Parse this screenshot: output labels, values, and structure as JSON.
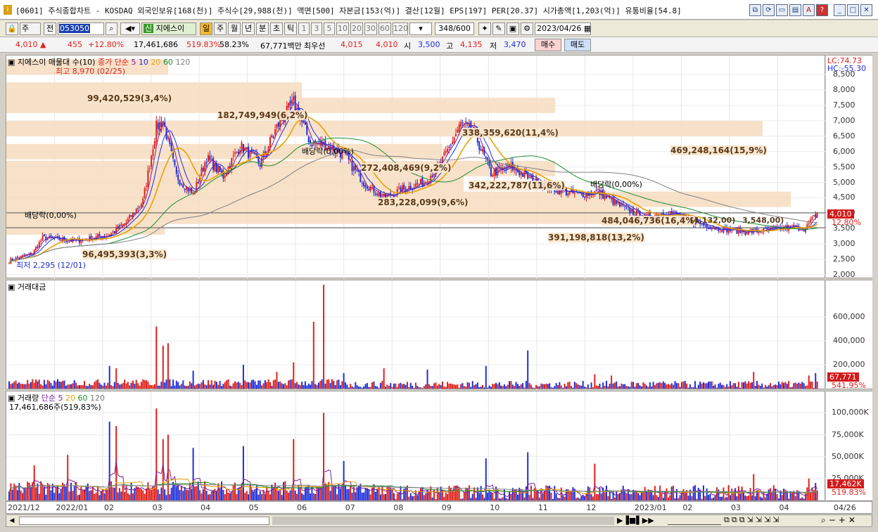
{
  "title": {
    "text": "[0601] 주식종합차트 - KOSDAQ 외국인보유[168(천)] 주식수[29,988(천)] 액면[500] 자본금[153(억)] 결산[12월] EPS[197] PER[20.37] 시가총액[1,203(억)] 유통비율[54.8]",
    "buttons": [
      "restore-icon",
      "refresh-icon",
      "window-icon",
      "print-icon",
      "font-icon",
      "help-icon",
      "minimize-icon",
      "maximize-icon",
      "close-icon"
    ]
  },
  "toolbar1": {
    "market": "주",
    "prev": "전",
    "code": "053050",
    "stock_name": "지에스이",
    "periods": [
      "일",
      "주",
      "월",
      "년",
      "분",
      "초",
      "틱"
    ],
    "active_period": "일",
    "minutes": [
      "1",
      "3",
      "5",
      "10",
      "20",
      "30",
      "60",
      "120"
    ],
    "count": "348",
    "count_total": "/600",
    "date": "2023/04/26"
  },
  "quote": {
    "price": "4,010",
    "change": "455",
    "change_pct": "+12.80%",
    "volume": "17,461,686",
    "vol_pct": "519.83%",
    "ratio": "58.23%",
    "amount": "67,771백만",
    "best_label": "최우선",
    "best_ask": "4,015",
    "best_bid": "4,010",
    "open_label": "시",
    "open": "3,500",
    "high_label": "고",
    "high": "4,135",
    "low_label": "저",
    "low": "3,470",
    "buy": "매수",
    "sell": "매도"
  },
  "price_panel": {
    "title": "지에스이 매물대 수(10)",
    "ma_title": "종가 단순",
    "ma_periods": [
      "5",
      "10",
      "20",
      "60",
      "120"
    ],
    "lc": "LC:74.73",
    "hc": "HC:-55.30",
    "y_ticks": [
      "8,500",
      "8,000",
      "7,500",
      "7,000",
      "6,500",
      "6,000",
      "5,500",
      "5,000",
      "4,500",
      "4,000",
      "3,500",
      "3,000",
      "2,500",
      "2,000"
    ],
    "last_price": "4,010",
    "last_pct": "12.80%",
    "high_note": "최고 8,970 (02/25)",
    "low_note": "최저 2,295 (12/01)",
    "profile_labels": [
      "99,420,529(3,4%)",
      "182,749,949(6,2%)",
      "338,359,620(11,4%)",
      "469,248,164(15,9%)",
      "272,408,469(9,2%)",
      "342,222,787(11,6%)",
      "283,228,099(9,6%)",
      "484,046,736(16,4%)",
      "391,198,818(13,2%)",
      "96,495,393(3,3%)"
    ],
    "dividend_labels": [
      "배당락(0,00%)",
      "배당락(0,00%)",
      "배당락(0,00%)"
    ],
    "box_labels": [
      "(4,132,00)",
      "3,548,00)"
    ]
  },
  "amount_panel": {
    "title": "거래대금",
    "y_ticks": [
      "600,000",
      "400,000",
      "200,000"
    ],
    "last_value": "67,771",
    "last_pct": "541.95%"
  },
  "volume_panel": {
    "title": "거래량",
    "ma_title": "단순",
    "ma_periods": [
      "5",
      "20",
      "60",
      "120"
    ],
    "value_line": "17,461,686주(519,83%)",
    "y_ticks": [
      "100,000K",
      "75,000K",
      "50,000K",
      "25,000K"
    ],
    "last_value": "17,462K",
    "last_pct": "519.83%"
  },
  "x_axis": [
    "2021/12",
    "2022/01",
    "02",
    "03",
    "04",
    "05",
    "06",
    "07",
    "08",
    "09",
    "10",
    "11",
    "12",
    "2023/01",
    "02",
    "03",
    "04"
  ],
  "x_last": "04/26",
  "colors": {
    "up": "#e0201b",
    "down": "#1f2fd8",
    "ma5": "#7a1fa0",
    "ma20": "#e8a200",
    "ma60": "#1f8a2f",
    "ma120": "#808080",
    "profile": "#f6dcc0"
  }
}
